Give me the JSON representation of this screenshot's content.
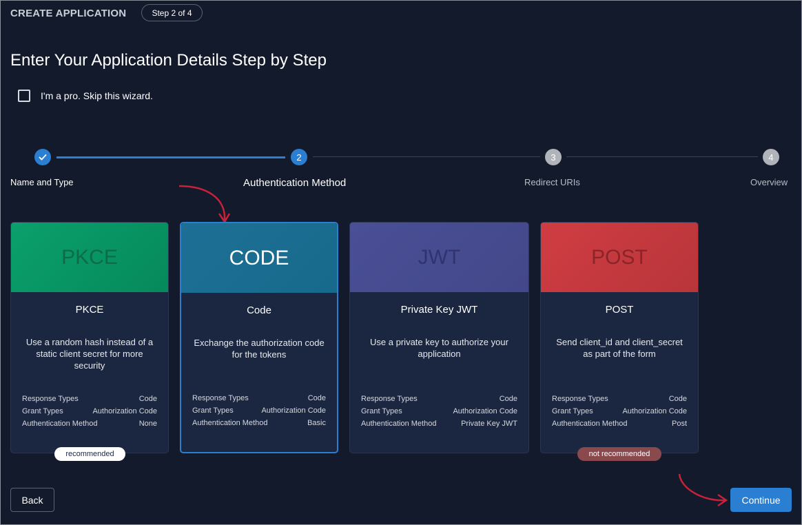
{
  "header": {
    "app_heading": "CREATE APPLICATION",
    "step_badge": "Step 2 of 4"
  },
  "page": {
    "title": "Enter Your Application Details Step by Step",
    "skip_wizard_label": "I'm a pro. Skip this wizard."
  },
  "stepper": {
    "steps": [
      {
        "number": "1",
        "label": "Name and Type",
        "state": "done",
        "icon": "check-icon"
      },
      {
        "number": "2",
        "label": "Authentication Method",
        "state": "active"
      },
      {
        "number": "3",
        "label": "Redirect URIs",
        "state": "todo"
      },
      {
        "number": "4",
        "label": "Overview",
        "state": "todo"
      }
    ]
  },
  "cards": [
    {
      "banner": "PKCE",
      "name": "PKCE",
      "description": "Use a random hash instead of a static client secret for more security",
      "color": "#0a9a67",
      "selected": false,
      "props": [
        {
          "key": "Response Types",
          "value": "Code"
        },
        {
          "key": "Grant Types",
          "value": "Authorization Code"
        },
        {
          "key": "Authentication Method",
          "value": "None"
        }
      ],
      "tag": "recommended"
    },
    {
      "banner": "CODE",
      "name": "Code",
      "description": "Exchange the authorization code for the tokens",
      "color": "#1a6e96",
      "selected": true,
      "props": [
        {
          "key": "Response Types",
          "value": "Code"
        },
        {
          "key": "Grant Types",
          "value": "Authorization Code"
        },
        {
          "key": "Authentication Method",
          "value": "Basic"
        }
      ]
    },
    {
      "banner": "JWT",
      "name": "Private Key JWT",
      "description": "Use a private key to authorize your application",
      "color": "#474c92",
      "selected": false,
      "props": [
        {
          "key": "Response Types",
          "value": "Code"
        },
        {
          "key": "Grant Types",
          "value": "Authorization Code"
        },
        {
          "key": "Authentication Method",
          "value": "Private Key JWT"
        }
      ]
    },
    {
      "banner": "POST",
      "name": "POST",
      "description": "Send client_id and client_secret as part of the form",
      "color": "#c63a3e",
      "selected": false,
      "props": [
        {
          "key": "Response Types",
          "value": "Code"
        },
        {
          "key": "Grant Types",
          "value": "Authorization Code"
        },
        {
          "key": "Authentication Method",
          "value": "Post"
        }
      ],
      "tag": "not recommended"
    }
  ],
  "footer": {
    "back_label": "Back",
    "continue_label": "Continue"
  },
  "colors": {
    "background": "#131a2b",
    "accent": "#2b7fd2",
    "annotation": "#c8223a"
  }
}
